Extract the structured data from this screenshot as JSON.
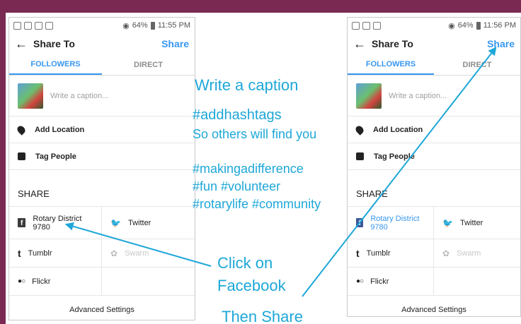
{
  "phone1": {
    "status": {
      "battery": "64%",
      "time": "11:55 PM"
    },
    "title": "Share To",
    "share_label": "Share",
    "tabs": [
      "FOLLOWERS",
      "DIRECT"
    ],
    "caption_placeholder": "Write a caption...",
    "add_location": "Add Location",
    "tag_people": "Tag People",
    "share_header": "SHARE",
    "services": {
      "facebook": "Rotary District 9780",
      "twitter": "Twitter",
      "tumblr": "Tumblr",
      "swarm": "Swarm",
      "flickr": "Flickr"
    },
    "advanced": "Advanced Settings"
  },
  "phone2": {
    "status": {
      "battery": "64%",
      "time": "11:56 PM"
    },
    "title": "Share To",
    "share_label": "Share",
    "tabs": [
      "FOLLOWERS",
      "DIRECT"
    ],
    "caption_placeholder": "Write a caption...",
    "add_location": "Add Location",
    "tag_people": "Tag People",
    "share_header": "SHARE",
    "services": {
      "facebook": "Rotary District 9780",
      "twitter": "Twitter",
      "tumblr": "Tumblr",
      "swarm": "Swarm",
      "flickr": "Flickr"
    },
    "advanced": "Advanced Settings"
  },
  "annotations": {
    "caption": "Write a caption",
    "hashtags": "#addhashtags",
    "others": "So others will find you",
    "tags_line1": "#makingadifference",
    "tags_line2": "#fun #volunteer",
    "tags_line3": "#rotarylife #community",
    "click_line1": "Click on",
    "click_line2": "Facebook",
    "then_share": "Then Share"
  },
  "colors": {
    "accent": "#3897f0",
    "annotation": "#1ea7d8",
    "frame": "#7a2a52",
    "facebook": "#3b5998"
  }
}
